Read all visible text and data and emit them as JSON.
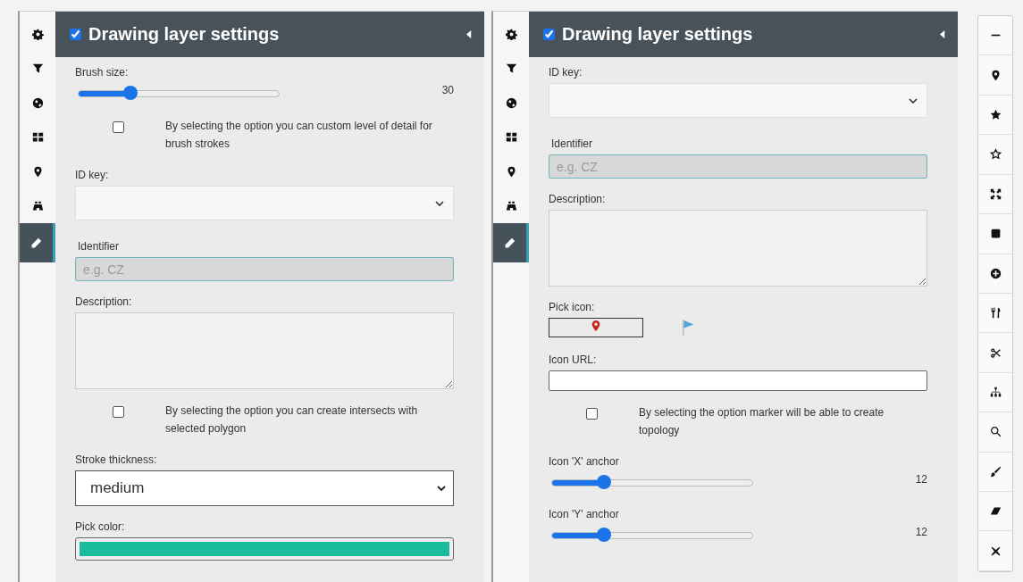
{
  "panels": [
    {
      "rail": [
        {
          "selected": false
        },
        {
          "selected": false
        },
        {
          "selected": false
        },
        {
          "selected": false
        },
        {
          "selected": false
        },
        {
          "selected": false
        },
        {
          "selected": true
        }
      ],
      "header": {
        "checked": true,
        "title": "Drawing layer settings"
      },
      "fields": [
        {
          "kind": "slider",
          "label": "Brush size:",
          "reading": "30",
          "level": 0.26
        },
        {
          "kind": "checkbox",
          "checked": false,
          "text": "By selecting the option you can custom level of detail for brush strokes"
        },
        {
          "kind": "select",
          "label": "ID key:"
        },
        {
          "kind": "text",
          "label": "Identifier",
          "placeholder": "e.g. CZ"
        },
        {
          "kind": "textarea",
          "label": "Description:"
        },
        {
          "kind": "checkbox",
          "checked": false,
          "text": "By selecting the option you can create intersects with selected polygon"
        },
        {
          "kind": "dropdown",
          "label": "Stroke thickness:",
          "value": "medium"
        },
        {
          "kind": "color",
          "label": "Pick color:",
          "color": "#1abc9c"
        }
      ]
    },
    {
      "rail": [
        {
          "selected": false
        },
        {
          "selected": false
        },
        {
          "selected": false
        },
        {
          "selected": false
        },
        {
          "selected": false
        },
        {
          "selected": false
        },
        {
          "selected": true
        }
      ],
      "header": {
        "checked": true,
        "title": "Drawing layer settings"
      },
      "fields": [
        {
          "kind": "select",
          "label": "ID key:"
        },
        {
          "kind": "text",
          "label": "Identifier",
          "placeholder": "e.g. CZ"
        },
        {
          "kind": "textarea",
          "label": "Description:"
        },
        {
          "kind": "iconpicker",
          "label": "Pick icon:"
        },
        {
          "kind": "url",
          "label": "Icon URL:"
        },
        {
          "kind": "checkbox",
          "checked": false,
          "text": "By selecting the option marker will be able to create topology"
        },
        {
          "kind": "slider",
          "label": "Icon 'X' anchor",
          "reading": "12",
          "level": 0.26
        },
        {
          "kind": "slider",
          "label": "Icon 'Y' anchor",
          "reading": "12",
          "level": 0.26
        }
      ]
    }
  ]
}
